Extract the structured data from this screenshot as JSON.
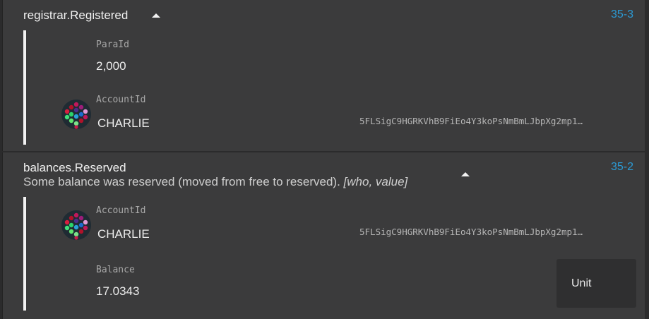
{
  "events": [
    {
      "title": "registrar.Registered",
      "index": "35-3",
      "fields": {
        "paraid_label": "ParaId",
        "paraid_value": "2,000",
        "account_label": "AccountId",
        "account_name": "CHARLIE",
        "account_address": "5FLSigC9HGRKVhB9FiEo4Y3koPsNmBmLJbpXg2mp1…"
      }
    },
    {
      "title": "balances.Reserved",
      "index": "35-2",
      "description": "Some balance was reserved (moved from free to reserved).",
      "description_args": "[who, value]",
      "fields": {
        "account_label": "AccountId",
        "account_name": "CHARLIE",
        "account_address": "5FLSigC9HGRKVhB9FiEo4Y3koPsNmBmLJbpXg2mp1…",
        "balance_label": "Balance",
        "balance_value": "17.0343",
        "unit_label": "Unit"
      }
    }
  ],
  "colors": {
    "background": "#2b2b2c",
    "panel": "#3b3b3c",
    "index_link": "#2b9ad4",
    "accent_bar": "#f2f2f2"
  },
  "icons": {
    "expand_toggle": "caret-up-icon",
    "identity": "polkadot-identicon"
  }
}
